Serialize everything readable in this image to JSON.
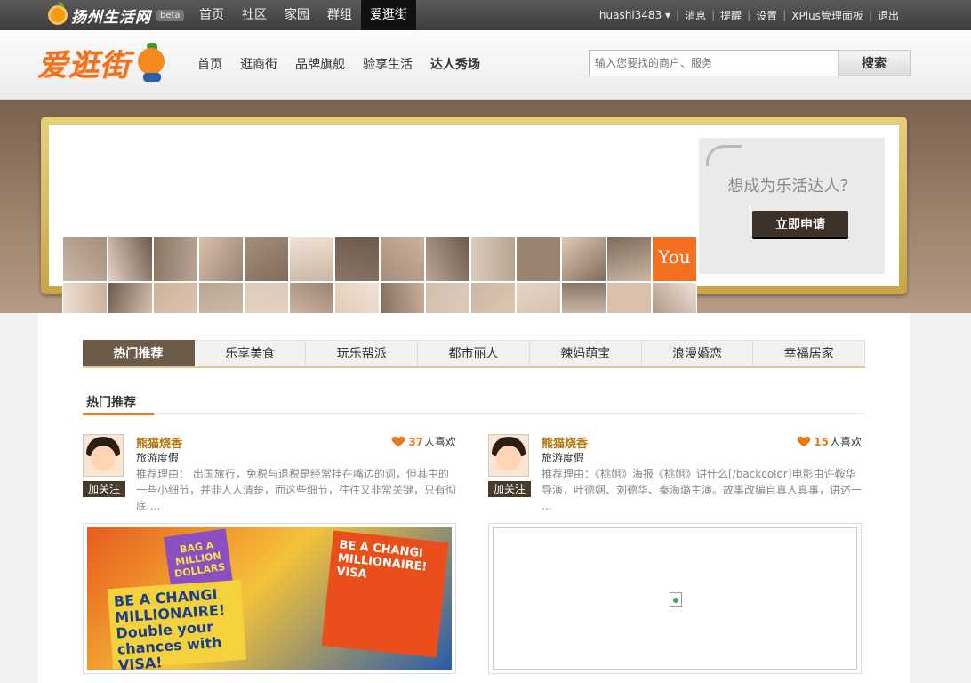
{
  "site": {
    "name": "扬州生活网",
    "beta": "beta"
  },
  "topnav": [
    {
      "label": "首页"
    },
    {
      "label": "社区"
    },
    {
      "label": "家园"
    },
    {
      "label": "群组"
    },
    {
      "label": "爱逛街",
      "active": true
    }
  ],
  "user": {
    "name": "huashi3483 ▾",
    "links": [
      "消息",
      "提醒",
      "设置",
      "XPlus管理面板",
      "退出"
    ]
  },
  "brand": {
    "name": "爱逛街"
  },
  "mainnav": [
    "首页",
    "逛商街",
    "品牌旗舰",
    "验享生活",
    "达人秀场"
  ],
  "search": {
    "placeholder": "输入您要找的商户、服务",
    "button": "搜索"
  },
  "banner": {
    "you_tile": "You",
    "question": "想成为乐活达人？",
    "apply_button": "立即申请"
  },
  "tabs": [
    "热门推荐",
    "乐享美食",
    "玩乐帮派",
    "都市丽人",
    "辣妈萌宝",
    "浪漫婚恋",
    "幸福居家"
  ],
  "section_title": "热门推荐",
  "cards": [
    {
      "name": "熊猫烧香",
      "category": "旅游度假",
      "follow": "加关注",
      "likes": "37",
      "likes_suffix": "人喜欢",
      "reason": "推荐理由：  出国旅行，免税与退税是经常挂在嘴边的词，但其中的一些小细节，并非人人清楚，而这些细节，往往又非常关键，只有彻底 ...",
      "image_texts": {
        "bag": "BAG A MILLION DOLLARS",
        "sign1": "BE A CHANGI MILLIONAIRE! Double your chances with VISA!",
        "sign2": "BE A CHANGI MILLIONAIRE! VISA"
      }
    },
    {
      "name": "熊猫烧香",
      "category": "旅游度假",
      "follow": "加关注",
      "likes": "15",
      "likes_suffix": "人喜欢",
      "reason": "推荐理由：《桃姐》海报《桃姐》讲什么[/backcolor]电影由许鞍华导演，叶德娴、刘德华、秦海璐主演。故事改编自真人真事，讲述一 ..."
    }
  ],
  "colors": {
    "accent": "#e8781c",
    "tab_active": "#6d5b49",
    "frame_gold": "#c9a546"
  }
}
